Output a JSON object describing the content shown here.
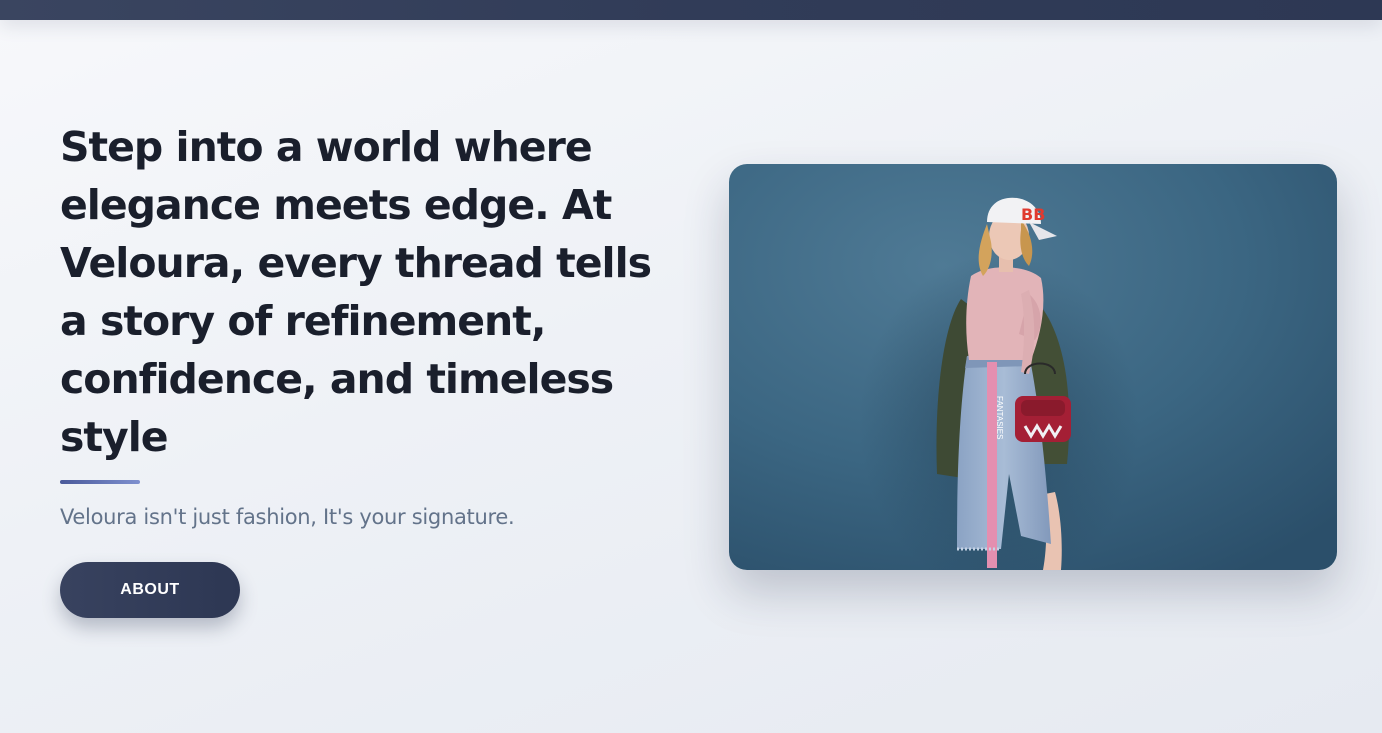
{
  "hero": {
    "headline": "Step into a world where elegance meets edge. At Veloura, every thread tells a story of refinement, confidence, and timeless style",
    "tagline": "Veloura isn't just fashion, It's your signature.",
    "cta_label": "ABOUT"
  },
  "photo": {
    "cap_text": "BB",
    "skirt_text": "FANTASIES",
    "subject": "fashion-model-photo"
  },
  "colors": {
    "topbar": "#313c58",
    "headline": "#1a1f2c",
    "tagline": "#63738a",
    "button": "#333d5a",
    "accent": "#5b6cb0"
  }
}
